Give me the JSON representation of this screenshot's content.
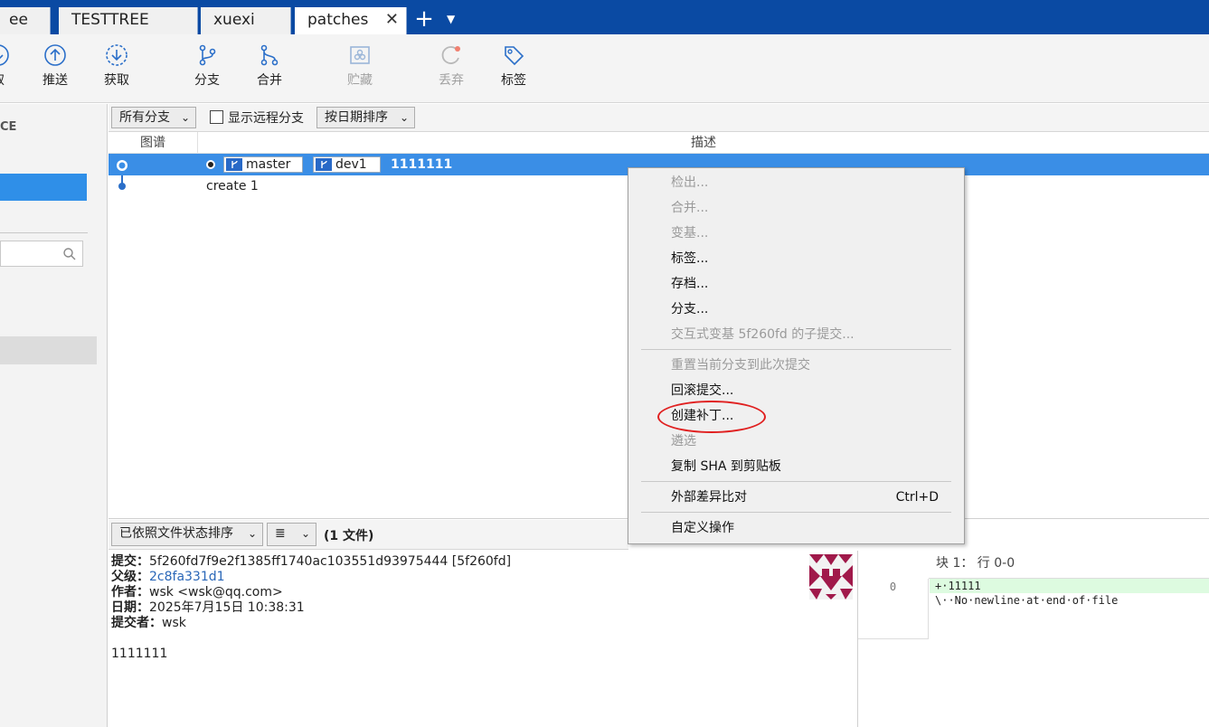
{
  "tabs": [
    {
      "label": "ee"
    },
    {
      "label": "TESTTREE"
    },
    {
      "label": "xuexi"
    },
    {
      "label": "patches",
      "close": "✕"
    }
  ],
  "tab_add": "+",
  "tab_dropdown": "▼",
  "toolbar": {
    "items": [
      {
        "label": "取",
        "icon": "pull-icon"
      },
      {
        "label": "推送",
        "icon": "push-icon"
      },
      {
        "label": "获取",
        "icon": "fetch-icon"
      },
      {
        "label": "分支",
        "icon": "branch-icon"
      },
      {
        "label": "合并",
        "icon": "merge-icon"
      },
      {
        "label": "贮藏",
        "icon": "stash-icon",
        "disabled": true
      },
      {
        "label": "丢弃",
        "icon": "discard-icon",
        "disabled": true
      },
      {
        "label": "标签",
        "icon": "tag-icon"
      }
    ]
  },
  "sidebar": {
    "header": "CE"
  },
  "filter": {
    "branches": "所有分支",
    "show_remote": "显示远程分支",
    "sort": "按日期排序",
    "chevron": "⌄"
  },
  "list_header": {
    "graph": "图谱",
    "description": "描述"
  },
  "commits": [
    {
      "branches": [
        "master",
        "dev1"
      ],
      "message": "1111111"
    },
    {
      "message": "create 1"
    }
  ],
  "lower": {
    "sort": "已依照文件状态排序",
    "view_icon": "≣",
    "file_count": "(1 文件)"
  },
  "details": {
    "commit_label": "提交：",
    "commit_value": "5f260fd7f9e2f1385ff1740ac103551d93975444 [5f260fd]",
    "parent_label": "父级：",
    "parent_value": "2c8fa331d1",
    "author_label": "作者：",
    "author_value": "wsk <wsk@qq.com>",
    "date_label": "日期：",
    "date_value": "2025年7月15日 10:38:31",
    "committer_label": "提交者：",
    "committer_value": "wsk",
    "message": "1111111"
  },
  "diff": {
    "header": "块 1： 行 0-0",
    "gutter": "0",
    "lines": [
      {
        "text": "+·11111",
        "type": "added"
      },
      {
        "text": "\\··No·newline·at·end·of·file",
        "type": "context"
      }
    ]
  },
  "context_menu": {
    "items": [
      {
        "label": "检出...",
        "disabled": true
      },
      {
        "label": "合并...",
        "disabled": true
      },
      {
        "label": "变基...",
        "disabled": true
      },
      {
        "label": "标签..."
      },
      {
        "label": "存档..."
      },
      {
        "label": "分支..."
      },
      {
        "label": "交互式变基 5f260fd 的子提交...",
        "disabled": true
      },
      {
        "label": "重置当前分支到此次提交",
        "disabled": true
      },
      {
        "label": "回滚提交..."
      },
      {
        "label": "创建补丁..."
      },
      {
        "label": "遴选",
        "disabled": true
      },
      {
        "label": "复制 SHA 到剪贴板"
      },
      {
        "label": "外部差异比对",
        "shortcut": "Ctrl+D"
      },
      {
        "label": "自定义操作"
      }
    ]
  },
  "colors": {
    "accent": "#0a4aa3",
    "selection": "#3a8ee6",
    "highlight": "#e02020"
  }
}
